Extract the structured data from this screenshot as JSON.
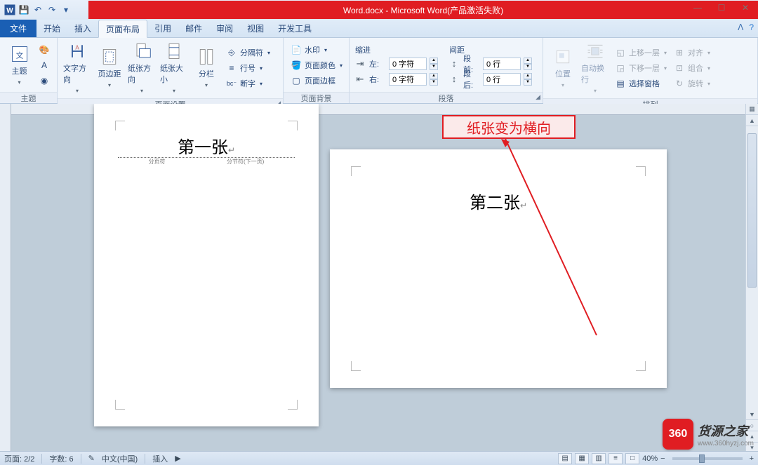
{
  "title": "Word.docx - Microsoft Word(产品激活失败)",
  "qa": {
    "word_icon": "W",
    "save": "💾",
    "undo": "↶",
    "redo": "↷"
  },
  "tabs": {
    "file": "文件",
    "items": [
      "开始",
      "插入",
      "页面布局",
      "引用",
      "邮件",
      "审阅",
      "视图",
      "开发工具"
    ]
  },
  "ribbon": {
    "theme": {
      "label": "主题",
      "main": "主题"
    },
    "page_setup": {
      "label": "页面设置",
      "text_dir": "文字方向",
      "margins": "页边距",
      "orientation": "纸张方向",
      "size": "纸张大小",
      "columns": "分栏",
      "breaks": "分隔符",
      "line_num": "行号",
      "hyphen": "断字"
    },
    "page_bg": {
      "label": "页面背景",
      "watermark": "水印",
      "color": "页面颜色",
      "border": "页面边框"
    },
    "paragraph": {
      "label": "段落",
      "indent_head": "缩进",
      "spacing_head": "间距",
      "left": "左:",
      "right": "右:",
      "before": "段前:",
      "after": "段后:",
      "char_val": "0 字符",
      "line_val": "0 行"
    },
    "arrange": {
      "label": "排列",
      "position": "位置",
      "wrap": "自动换行",
      "forward": "上移一层",
      "backward": "下移一层",
      "selection": "选择窗格",
      "align": "对齐",
      "group": "组合",
      "rotate": "旋转"
    }
  },
  "doc": {
    "page1_title": "第一张",
    "page_break": "分页符",
    "page_break_next": "分节符(下一页)",
    "page2_title": "第二张",
    "callout": "纸张变为横向"
  },
  "status": {
    "page": "页面: 2/2",
    "words": "字数: 6",
    "lang": "中文(中国)",
    "mode": "插入",
    "zoom": "40%"
  },
  "watermark": {
    "logo": "360",
    "name": "货源之家",
    "url": "www.360hyzj.com"
  }
}
